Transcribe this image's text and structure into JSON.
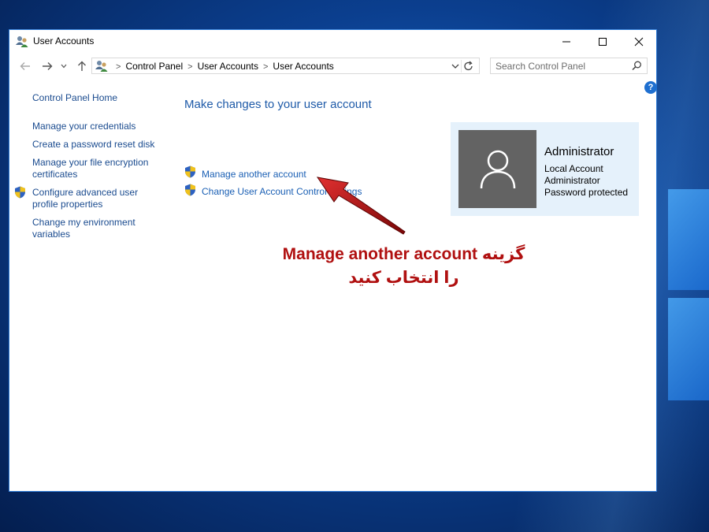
{
  "window": {
    "title": "User Accounts"
  },
  "address": {
    "crumbs": [
      "Control Panel",
      "User Accounts",
      "User Accounts"
    ]
  },
  "search": {
    "placeholder": "Search Control Panel"
  },
  "help": {
    "glyph": "?"
  },
  "sidebar": {
    "home": "Control Panel Home",
    "items": [
      "Manage your credentials",
      "Create a password reset disk",
      "Manage your file encryption certificates",
      "Configure advanced user profile properties",
      "Change my environment variables"
    ]
  },
  "main": {
    "title": "Make changes to your user account",
    "tasks": [
      "Manage another account",
      "Change User Account Control settings"
    ]
  },
  "user": {
    "name": "Administrator",
    "lines": [
      "Local Account",
      "Administrator",
      "Password protected"
    ]
  },
  "annotation": {
    "line1": "گزینه Manage another account",
    "line2": "را انتخاب کنید"
  },
  "colors": {
    "accent": "#1e5aa8",
    "annotation": "#b01010",
    "panel": "#e5f1fb"
  },
  "icons": {
    "app": "users-icon",
    "back": "arrow-left-icon",
    "forward": "arrow-right-icon",
    "up": "arrow-up-icon",
    "search": "search-icon",
    "shield": "uac-shield-icon",
    "avatar": "user-silhouette-icon"
  }
}
